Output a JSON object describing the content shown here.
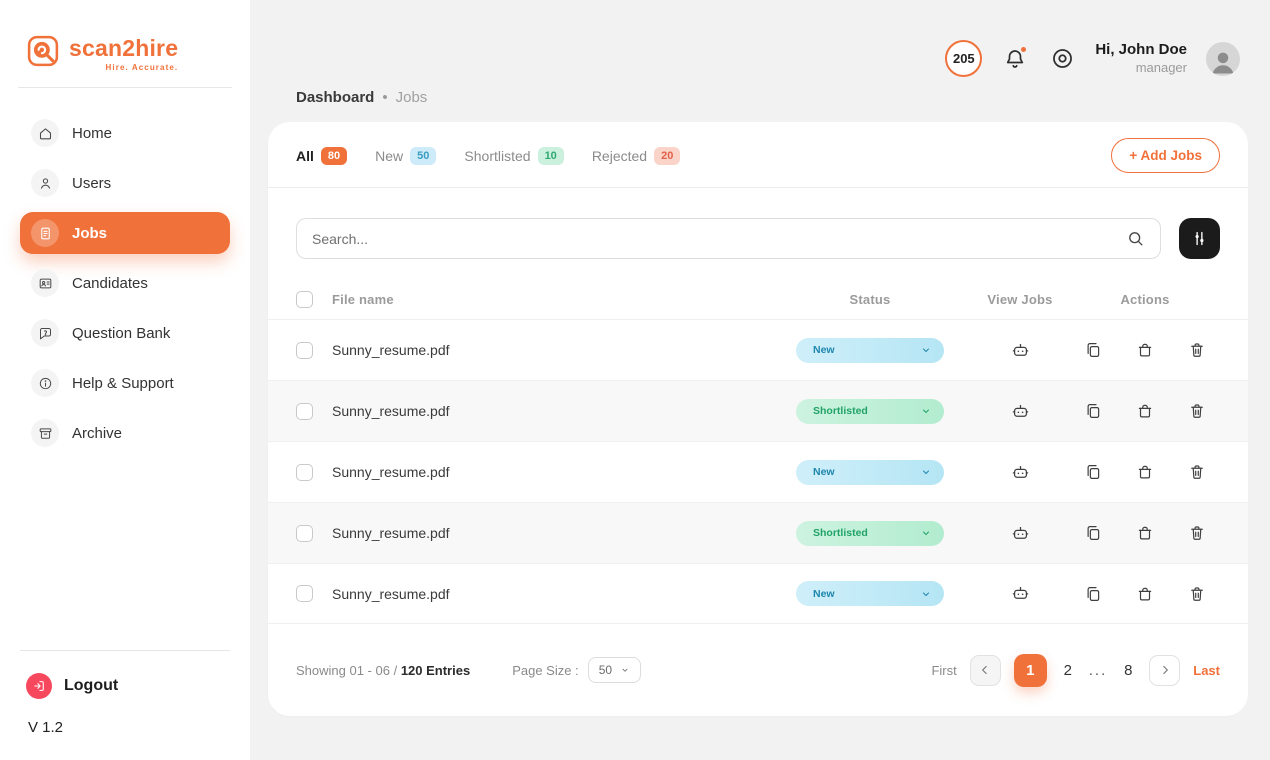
{
  "brand": {
    "name": "scan2hire",
    "tagline": "Hire. Accurate."
  },
  "sidebar": {
    "items": [
      {
        "label": "Home"
      },
      {
        "label": "Users"
      },
      {
        "label": "Jobs"
      },
      {
        "label": "Candidates"
      },
      {
        "label": "Question Bank"
      },
      {
        "label": "Help & Support"
      },
      {
        "label": "Archive"
      }
    ],
    "logout_label": "Logout",
    "version": "V 1.2"
  },
  "header": {
    "breadcrumb_parent": "Dashboard",
    "breadcrumb_separator": "•",
    "breadcrumb_current": "Jobs",
    "credits_count": "205",
    "user_greeting": "Hi, John Doe",
    "user_role": "manager"
  },
  "tabs": [
    {
      "label": "All",
      "count": "80"
    },
    {
      "label": "New",
      "count": "50"
    },
    {
      "label": "Shortlisted",
      "count": "10"
    },
    {
      "label": "Rejected",
      "count": "20"
    }
  ],
  "toolbar": {
    "add_jobs_label": "+ Add Jobs",
    "search_placeholder": "Search..."
  },
  "table": {
    "headers": {
      "file": "File name",
      "status": "Status",
      "view": "View Jobs",
      "actions": "Actions"
    },
    "rows": [
      {
        "file": "Sunny_resume.pdf",
        "status": "New"
      },
      {
        "file": "Sunny_resume.pdf",
        "status": "Shortlisted"
      },
      {
        "file": "Sunny_resume.pdf",
        "status": "New"
      },
      {
        "file": "Sunny_resume.pdf",
        "status": "Shortlisted"
      },
      {
        "file": "Sunny_resume.pdf",
        "status": "New"
      }
    ]
  },
  "pagination": {
    "showing_text": "Showing 01 - 06 /",
    "entries_text": "120 Entries",
    "page_size_label": "Page Size :",
    "page_size_value": "50",
    "first_label": "First",
    "page_1": "1",
    "page_2": "2",
    "ellipsis": "...",
    "page_8": "8",
    "last_label": "Last"
  },
  "colors": {
    "accent_orange": "#F0713A",
    "status_new_bg": "#C9EBF7",
    "status_new_text": "#1F86AC",
    "status_shortlisted_bg": "#C5F0DB",
    "status_shortlisted_text": "#21A268",
    "rejected_badge_bg": "#FAD3C9",
    "rejected_badge_text": "#E2604A",
    "logout_pink": "#F8485E",
    "filter_button_bg": "#1B1B1B"
  }
}
